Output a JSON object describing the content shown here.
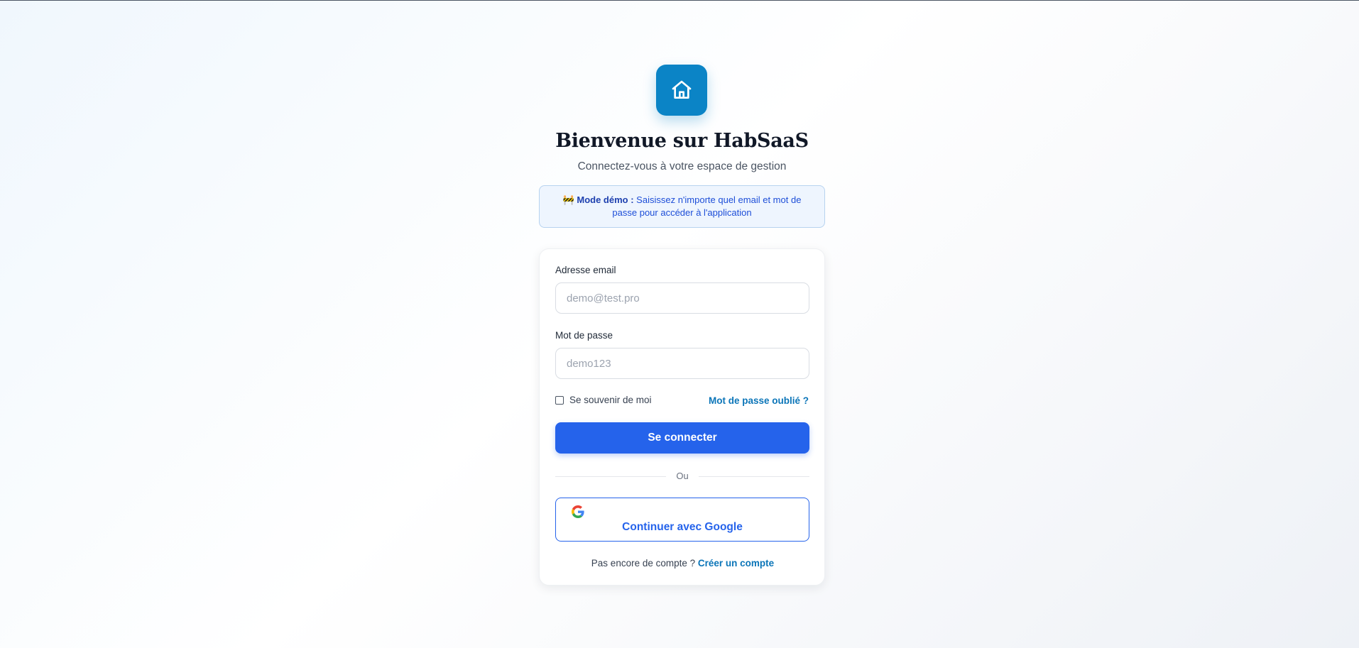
{
  "brand": {
    "logo_icon": "house-icon",
    "logo_color": "#0b84c6"
  },
  "header": {
    "title": "Bienvenue sur HabSaaS",
    "subtitle": "Connectez-vous à votre espace de gestion"
  },
  "demo_notice": {
    "icon": "🚧",
    "strong": "Mode démo :",
    "text": "Saisissez n'importe quel email et mot de passe pour accéder à l'application"
  },
  "form": {
    "email_label": "Adresse email",
    "email_placeholder": "demo@test.pro",
    "email_value": "",
    "password_label": "Mot de passe",
    "password_placeholder": "demo123",
    "password_value": "",
    "remember_label": "Se souvenir de moi",
    "remember_checked": false,
    "forgot_label": "Mot de passe oublié ?",
    "submit_label": "Se connecter",
    "divider_label": "Ou",
    "google_label": "Continuer avec Google",
    "google_icon": "google-icon"
  },
  "footer": {
    "prompt": "Pas encore de compte ?",
    "link": "Créer un compte"
  },
  "colors": {
    "primary": "#2563eb",
    "link": "#0b75b8",
    "notice_bg": "#eef5fe",
    "notice_border": "#b7d3ef"
  }
}
